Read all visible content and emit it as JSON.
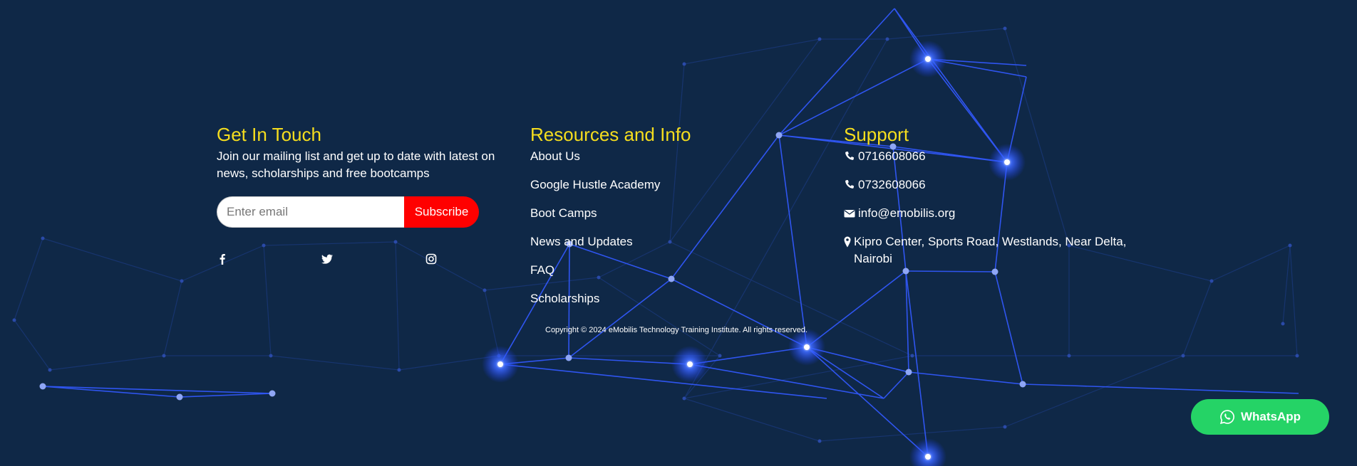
{
  "colors": {
    "background": "#0f2847",
    "heading": "#f5dd1e",
    "subscribe_button": "#ff0000",
    "whatsapp_button": "#25d366",
    "network_lines": "#2a4be0"
  },
  "contact": {
    "title": "Get In Touch",
    "intro": "Join our mailing list and get up to date with latest on news, scholarships and free bootcamps",
    "email_placeholder": "Enter email",
    "subscribe_label": "Subscribe",
    "social": [
      {
        "icon": "facebook-icon"
      },
      {
        "icon": "twitter-icon"
      },
      {
        "icon": "instagram-icon"
      }
    ]
  },
  "resources": {
    "title": "Resources and Info",
    "links": [
      "About Us",
      "Google Hustle Academy",
      "Boot Camps",
      "News and Updates",
      "FAQ",
      "Scholarships"
    ]
  },
  "support": {
    "title": "Support",
    "phone1": "0716608066",
    "phone2": "0732608066",
    "email": "info@emobilis.org",
    "address": "Kipro Center, Sports Road, Westlands, Near Delta, Nairobi"
  },
  "copyright": "Copyright © 2024 eMobilis Technology Training Institute. All rights reserved.",
  "whatsapp": {
    "label": "WhatsApp",
    "icon": "whatsapp-icon"
  }
}
